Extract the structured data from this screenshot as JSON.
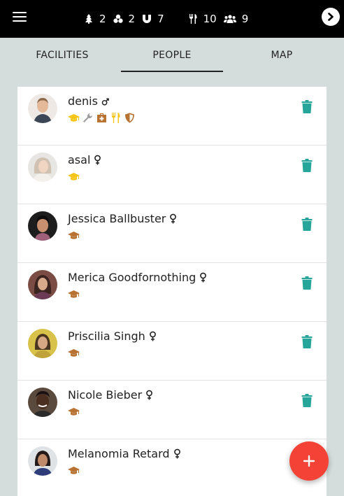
{
  "stats": [
    {
      "icon": "tree-icon",
      "value": "2"
    },
    {
      "icon": "hazard-icon",
      "value": "2"
    },
    {
      "icon": "magnet-icon",
      "value": "7"
    },
    {
      "icon": "utensils-icon",
      "value": "10"
    },
    {
      "icon": "people-icon",
      "value": "9"
    }
  ],
  "tabs": {
    "facilities": "FACILITIES",
    "people": "PEOPLE",
    "map": "MAP"
  },
  "colors": {
    "teal": "#26a69a",
    "gold": "#f5c518",
    "brown": "#b87333",
    "gray": "#9e9e9e",
    "fab": "#f44336"
  },
  "people": [
    {
      "name": "denis",
      "gender": "male",
      "roles": [
        "graduation-cap-icon",
        "wrench-icon",
        "medkit-icon",
        "utensils-icon",
        "shield-icon"
      ]
    },
    {
      "name": "asal",
      "gender": "female",
      "roles": [
        "graduation-cap-icon"
      ]
    },
    {
      "name": "Jessica Ballbuster",
      "gender": "female",
      "roles": [
        "graduation-cap-icon"
      ]
    },
    {
      "name": "Merica Goodfornothing",
      "gender": "female",
      "roles": [
        "graduation-cap-icon"
      ]
    },
    {
      "name": "Priscilia Singh",
      "gender": "female",
      "roles": [
        "graduation-cap-icon"
      ]
    },
    {
      "name": "Nicole Bieber",
      "gender": "female",
      "roles": [
        "graduation-cap-icon"
      ]
    },
    {
      "name": "Melanomia Retard",
      "gender": "female",
      "roles": [
        "graduation-cap-icon"
      ]
    }
  ]
}
